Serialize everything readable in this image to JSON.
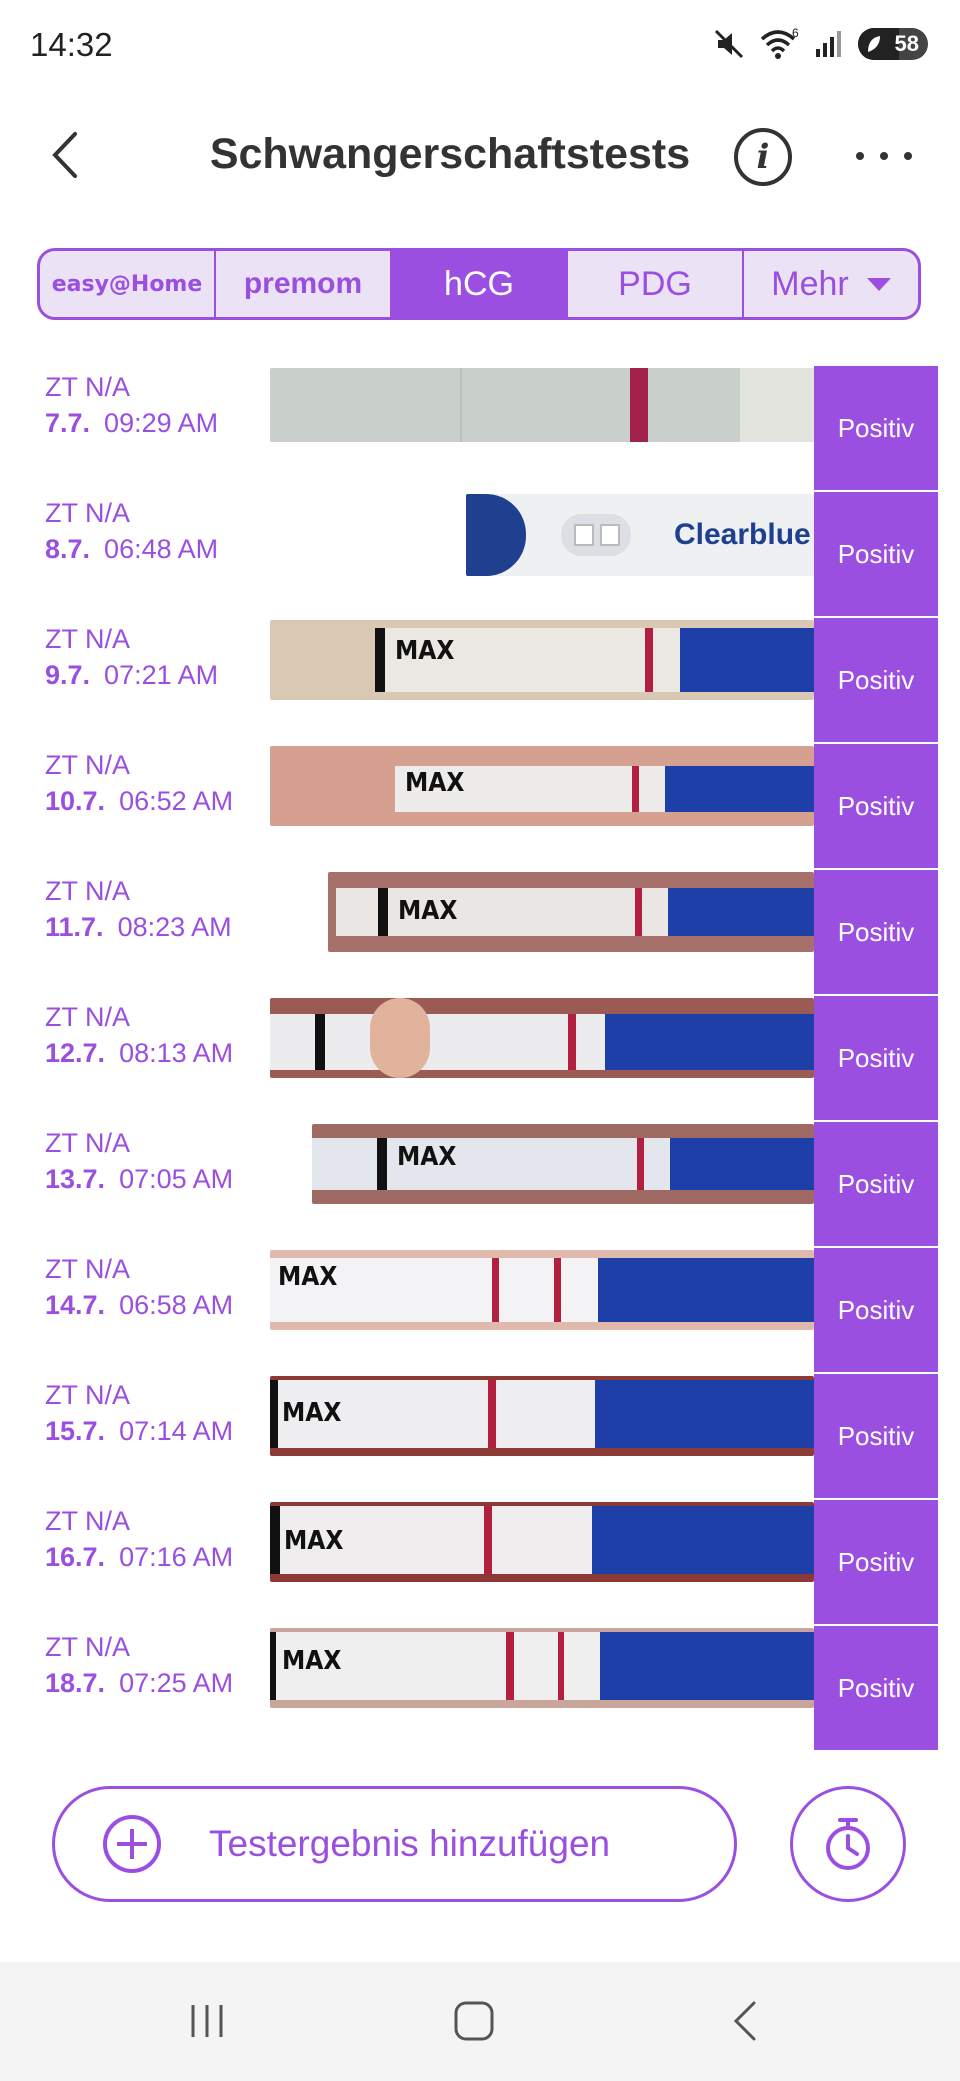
{
  "status_bar": {
    "time": "14:32",
    "battery": "58",
    "wifi_badge": "6"
  },
  "header": {
    "title": "Schwangerschaftstests"
  },
  "tabs": [
    {
      "label": "easy@Home",
      "active": false
    },
    {
      "label": "premom",
      "active": false
    },
    {
      "label": "hCG",
      "active": true
    },
    {
      "label": "PDG",
      "active": false
    },
    {
      "label": "Mehr",
      "active": false
    }
  ],
  "strip_text": {
    "max": "MAX",
    "brand": "Clearblue"
  },
  "tests": [
    {
      "cycle_day": "ZT N/A",
      "date": "7.7.",
      "time": "09:29 AM",
      "result": "Positiv"
    },
    {
      "cycle_day": "ZT N/A",
      "date": "8.7.",
      "time": "06:48 AM",
      "result": "Positiv"
    },
    {
      "cycle_day": "ZT N/A",
      "date": "9.7.",
      "time": "07:21 AM",
      "result": "Positiv"
    },
    {
      "cycle_day": "ZT N/A",
      "date": "10.7.",
      "time": "06:52 AM",
      "result": "Positiv"
    },
    {
      "cycle_day": "ZT N/A",
      "date": "11.7.",
      "time": "08:23 AM",
      "result": "Positiv"
    },
    {
      "cycle_day": "ZT N/A",
      "date": "12.7.",
      "time": "08:13 AM",
      "result": "Positiv"
    },
    {
      "cycle_day": "ZT N/A",
      "date": "13.7.",
      "time": "07:05 AM",
      "result": "Positiv"
    },
    {
      "cycle_day": "ZT N/A",
      "date": "14.7.",
      "time": "06:58 AM",
      "result": "Positiv"
    },
    {
      "cycle_day": "ZT N/A",
      "date": "15.7.",
      "time": "07:14 AM",
      "result": "Positiv"
    },
    {
      "cycle_day": "ZT N/A",
      "date": "16.7.",
      "time": "07:16 AM",
      "result": "Positiv"
    },
    {
      "cycle_day": "ZT N/A",
      "date": "18.7.",
      "time": "07:25 AM",
      "result": "Positiv"
    }
  ],
  "actions": {
    "add_result": "Testergebnis hinzufügen"
  },
  "colors": {
    "accent": "#9b4fe0",
    "tab_bg": "#ece2f6",
    "test_line": "#b3203f",
    "hcg_blue": "#1f3fa8"
  },
  "icons": {
    "back": "chevron-left-icon",
    "info": "info-icon",
    "more": "more-dots-icon",
    "add": "plus-circle-icon",
    "timer": "stopwatch-icon"
  }
}
